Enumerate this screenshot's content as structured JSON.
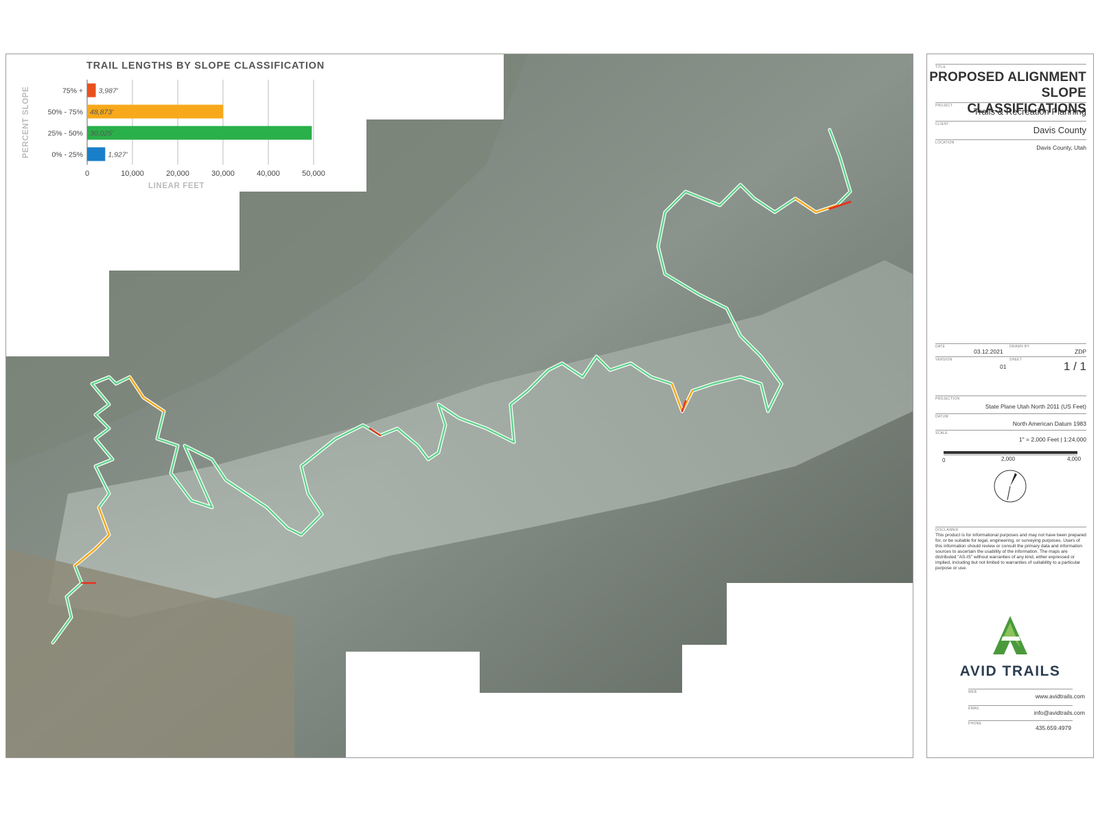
{
  "chart_data": {
    "type": "bar",
    "orientation": "horizontal",
    "title": "TRAIL LENGTHS BY SLOPE CLASSIFICATION",
    "xlabel": "LINEAR FEET",
    "ylabel": "PERCENT SLOPE",
    "categories": [
      "75% +",
      "50% - 75%",
      "25% - 50%",
      "0% - 25%"
    ],
    "values": [
      1900,
      30000,
      49600,
      3987
    ],
    "data_labels": [
      "3,987'",
      "48,873'",
      "30,025'",
      "1,927'"
    ],
    "colors": [
      "#e8511c",
      "#f7a81b",
      "#2ab04a",
      "#1a7fc9"
    ],
    "xticks": [
      "0",
      "10,000",
      "20,000",
      "30,000",
      "40,000",
      "50,000"
    ],
    "xlim": [
      0,
      50000
    ],
    "grid": true,
    "legend": "none"
  },
  "title_block": {
    "title_label": "TITLE",
    "title_line1": "PROPOSED ALIGNMENT",
    "title_line2": "SLOPE CLASSIFICATIONS",
    "project_label": "PROJECT",
    "project": "Trails & Recreation Planning",
    "client_label": "CLIENT",
    "client": "Davis County",
    "location_label": "LOCATION",
    "location": "Davis County, Utah",
    "date_label": "DATE",
    "date": "03.12.2021",
    "drawn_by_label": "DRAWN BY",
    "drawn_by": "ZDP",
    "version_label": "VERSION",
    "version": "01",
    "sheet_label": "SHEET",
    "sheet": "1 / 1",
    "projection_label": "PROJECTION",
    "projection": "State Plane Utah North 2011 (US Feet)",
    "datum_label": "DATUM",
    "datum": "North American Datum 1983",
    "scale_label": "SCALE",
    "scale": "1\" = 2,000 Feet | 1:24,000",
    "scale_ticks": [
      "0",
      "2,000",
      "4,000"
    ],
    "disclaimer_label": "DISCLAIMER",
    "disclaimer": "This product is for informational purposes and may not have been prepared for, or be suitable for legal, engineering, or surveying purposes. Users of this information should review or consult the primary data and information sources to ascertain the usability of the information. The maps are distributed \"AS-IS\" without warranties of any kind, either expressed or implied, including but not limited to warranties of suitability to a particular purpose or use.",
    "logo_text": "AVID TRAILS",
    "web_label": "WEB",
    "web": "www.avidtrails.com",
    "email_label": "EMAIL",
    "email": "info@avidtrails.com",
    "phone_label": "PHONE",
    "phone": "435.659.4979"
  },
  "colors": {
    "terrain_dark": "#5d665e",
    "terrain_light": "#b9c2bb",
    "trail_green": "#5fd38a",
    "trail_orange": "#f7a81b",
    "trail_red": "#e8311c",
    "logo_green": "#4a9a3c"
  }
}
